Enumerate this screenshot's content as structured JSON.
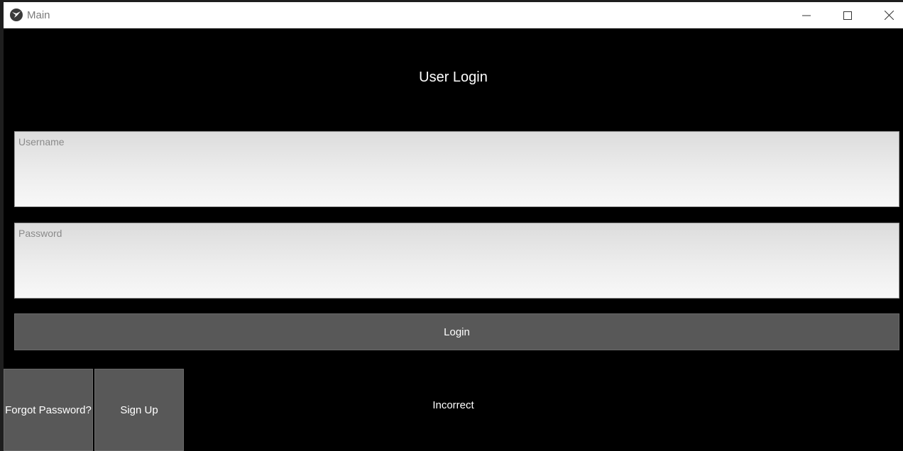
{
  "window": {
    "title": "Main",
    "controls": {
      "minimize": "minimize-icon",
      "maximize": "maximize-icon",
      "close": "close-icon"
    }
  },
  "form": {
    "heading": "User Login",
    "username_placeholder": "Username",
    "username_value": "",
    "password_placeholder": "Password",
    "password_value": "",
    "login_label": "Login",
    "forgot_label": "Forgot Password?",
    "signup_label": "Sign Up",
    "status_message": "Incorrect"
  },
  "colors": {
    "background": "#000000",
    "button": "#585858",
    "text": "#ffffff",
    "placeholder": "#8a8a8a"
  }
}
